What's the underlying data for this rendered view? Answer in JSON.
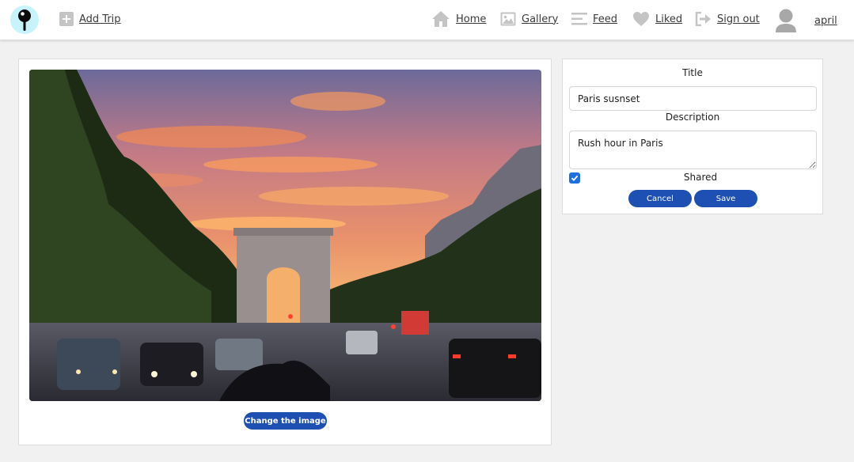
{
  "navbar": {
    "logo_icon": "map-pin-icon",
    "add_trip": {
      "label": "Add Trip",
      "icon": "plus-square-icon"
    },
    "home": {
      "label": "Home",
      "icon": "house-icon"
    },
    "gallery": {
      "label": "Gallery",
      "icon": "image-icon"
    },
    "feed": {
      "label": "Feed",
      "icon": "lines-icon"
    },
    "liked": {
      "label": "Liked",
      "icon": "heart-icon"
    },
    "sign_out": {
      "label": "Sign out",
      "icon": "sign-out-icon"
    },
    "user": {
      "label": "april",
      "icon": "user-avatar-icon"
    }
  },
  "image_panel": {
    "change_image_label": "Change the image"
  },
  "form": {
    "title_label": "Title",
    "title_value": "Paris susnset",
    "description_label": "Description",
    "description_value": "Rush hour in Paris",
    "shared_label": "Shared",
    "shared_checked": true,
    "cancel_label": "Cancel",
    "save_label": "Save"
  },
  "colors": {
    "accent": "#1e4fb3",
    "checkbox": "#1e6fe0",
    "logo_bg": "#c6f4fa",
    "nav_icon": "#c4c4c4"
  }
}
